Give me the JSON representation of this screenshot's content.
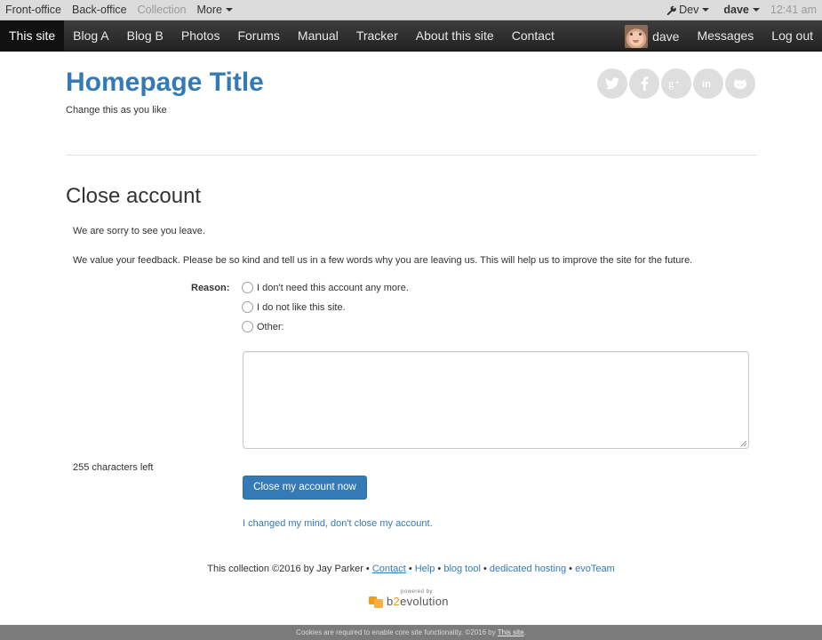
{
  "adminbar": {
    "left_items": [
      "Front-office",
      "Back-office",
      "Collection",
      "More"
    ],
    "dev_label": "Dev",
    "user_label": "dave",
    "time": "12:41 am"
  },
  "navbar": {
    "items": [
      "This site",
      "Blog A",
      "Blog B",
      "Photos",
      "Forums",
      "Manual",
      "Tracker",
      "About this site",
      "Contact"
    ],
    "active_item": "This site",
    "user_name": "dave",
    "messages_label": "Messages",
    "logout_label": "Log out"
  },
  "header": {
    "title": "Homepage Title",
    "tagline": "Change this as you like",
    "social_icons": [
      "twitter-icon",
      "facebook-icon",
      "googleplus-icon",
      "linkedin-icon",
      "github-icon"
    ]
  },
  "content": {
    "page_title": "Close account",
    "sorry_text": "We are sorry to see you leave.",
    "feedback_text": "We value your feedback. Please be so kind and tell us in a few words why you are leaving us. This will help us to improve the site for the future.",
    "reason_label": "Reason:",
    "reasons": [
      "I don't need this account any more.",
      "I do not like this site.",
      "Other:"
    ],
    "chars_left": "255 characters left",
    "submit_label": "Close my account now",
    "cancel_link": "I changed my mind, don't close my account."
  },
  "footer": {
    "prefix": "This collection ©2016 by Jay Parker • ",
    "contact": "Contact",
    "sep": " • ",
    "help": "Help",
    "blog_tool": "blog tool",
    "hosting": "dedicated hosting",
    "evoteam": "evoTeam",
    "powered_by": "powered by",
    "logo_b": "b",
    "logo_2": "2",
    "logo_rest": "evolution"
  },
  "cookie_bar": {
    "text": "Cookies are required to enable core site functionality. ©2016 by ",
    "link": "This site",
    "suffix": "."
  },
  "colors": {
    "link": "#337ab7",
    "navbar_bg": "#2b2b2b",
    "button_bg": "#337ab7",
    "accent_orange": "#f39c12"
  }
}
